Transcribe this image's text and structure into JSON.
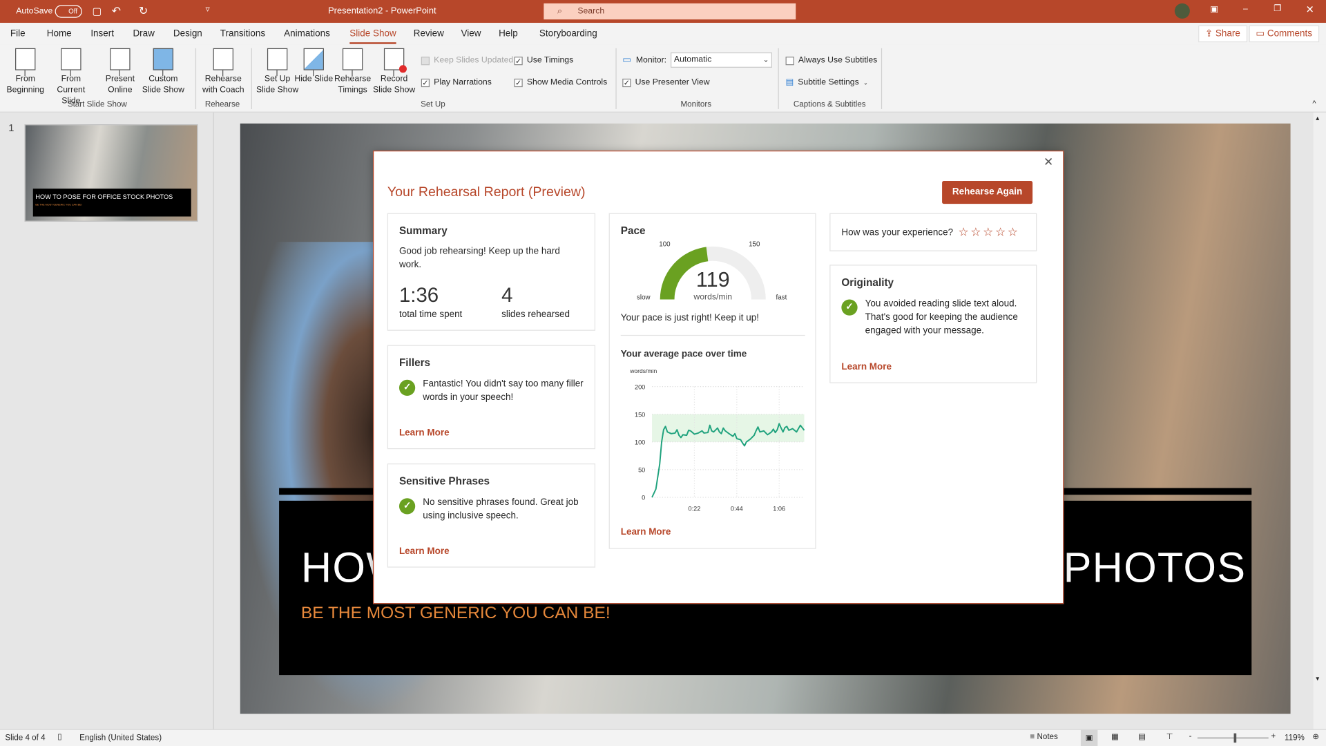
{
  "titlebar": {
    "autosave_label": "AutoSave",
    "autosave_state": "Off",
    "doc_title": "Presentation2 - PowerPoint",
    "search_placeholder": "Search"
  },
  "tabs": [
    {
      "label": "File"
    },
    {
      "label": "Home"
    },
    {
      "label": "Insert"
    },
    {
      "label": "Draw"
    },
    {
      "label": "Design"
    },
    {
      "label": "Transitions"
    },
    {
      "label": "Animations"
    },
    {
      "label": "Slide Show",
      "active": true
    },
    {
      "label": "Review"
    },
    {
      "label": "View"
    },
    {
      "label": "Help"
    },
    {
      "label": "Storyboarding"
    }
  ],
  "share_label": "Share",
  "comments_label": "Comments",
  "ribbon": {
    "buttons": [
      "From Beginning",
      "From Current Slide",
      "Present Online",
      "Custom Slide Show",
      "Rehearse with Coach",
      "Set Up Slide Show",
      "Hide Slide",
      "Rehearse Timings",
      "Record Slide Show"
    ],
    "checks": {
      "keep_slides_updated": "Keep Slides Updated",
      "use_timings": "Use Timings",
      "play_narrations": "Play Narrations",
      "show_media_controls": "Show Media Controls",
      "use_presenter_view": "Use Presenter View",
      "always_use_subtitles": "Always Use Subtitles"
    },
    "monitor_label": "Monitor:",
    "monitor_value": "Automatic",
    "subtitle_settings": "Subtitle Settings",
    "groups": [
      "Start Slide Show",
      "Rehearse",
      "Set Up",
      "Monitors",
      "Captions & Subtitles"
    ]
  },
  "thumbnail": {
    "number": "1",
    "title": "HOW TO POSE FOR OFFICE STOCK PHOTOS",
    "subtitle": "BE THE MOST GENERIC YOU CAN BE!"
  },
  "slide": {
    "title": "HOW TO POSE FOR OFFICE STOCK PHOTOS",
    "subtitle": "BE THE MOST GENERIC YOU CAN BE!"
  },
  "dialog": {
    "title": "Your Rehearsal Report (Preview)",
    "rehearse_again": "Rehearse Again",
    "summary": {
      "heading": "Summary",
      "message": "Good job rehearsing! Keep up the hard work.",
      "time": "1:36",
      "time_label": "total time spent",
      "slides": "4",
      "slides_label": "slides rehearsed"
    },
    "fillers": {
      "heading": "Fillers",
      "message": "Fantastic! You didn't say too many filler words in your speech!",
      "learn_more": "Learn More"
    },
    "sensitive": {
      "heading": "Sensitive Phrases",
      "message": "No sensitive phrases found. Great job using inclusive speech.",
      "learn_more": "Learn More"
    },
    "pace": {
      "heading": "Pace",
      "value": "119",
      "unit": "words/min",
      "label_slow": "slow",
      "label_fast": "fast",
      "tick_100": "100",
      "tick_150": "150",
      "message": "Your pace is just right! Keep it up!",
      "chart_title": "Your average pace over time",
      "learn_more": "Learn More"
    },
    "experience": {
      "question": "How was your experience?",
      "rating": 0,
      "max": 5
    },
    "originality": {
      "heading": "Originality",
      "message": "You avoided reading slide text aloud. That's good for keeping the audience engaged with your message.",
      "learn_more": "Learn More"
    }
  },
  "colors": {
    "accent": "#b7472a",
    "gauge_fill": "#6aa121",
    "line": "#1fa27d",
    "band": "#e6f6e6"
  },
  "chart_data": {
    "type": "line",
    "title": "Your average pace over time",
    "ylabel": "words/min",
    "ylim": [
      0,
      200
    ],
    "yticks": [
      0,
      50,
      100,
      150,
      200
    ],
    "xticks": [
      "0:22",
      "0:44",
      "1:06"
    ],
    "grid": true,
    "target_band": [
      100,
      150
    ],
    "x_seconds": [
      0,
      2,
      4,
      5,
      6,
      7,
      8,
      10,
      12,
      13,
      14,
      15,
      16,
      18,
      19,
      20,
      22,
      24,
      26,
      27,
      29,
      30,
      31,
      32,
      34,
      35,
      36,
      37,
      38,
      40,
      42,
      43,
      44,
      46,
      47,
      48,
      49,
      51,
      53,
      54,
      55,
      56,
      58,
      60,
      62,
      63,
      64,
      65,
      66,
      67,
      68,
      69,
      70,
      71,
      73,
      75,
      77,
      79
    ],
    "values": [
      0,
      15,
      60,
      100,
      122,
      128,
      118,
      115,
      116,
      122,
      112,
      108,
      113,
      112,
      121,
      120,
      114,
      116,
      120,
      116,
      117,
      130,
      120,
      118,
      125,
      118,
      115,
      125,
      120,
      115,
      110,
      115,
      106,
      104,
      98,
      93,
      100,
      105,
      112,
      120,
      127,
      118,
      120,
      113,
      118,
      123,
      117,
      122,
      133,
      125,
      118,
      126,
      128,
      121,
      124,
      118,
      130,
      121
    ]
  },
  "statusbar": {
    "slide_info": "Slide 4 of 4",
    "language": "English (United States)",
    "notes": "Notes",
    "zoom": "119%"
  }
}
